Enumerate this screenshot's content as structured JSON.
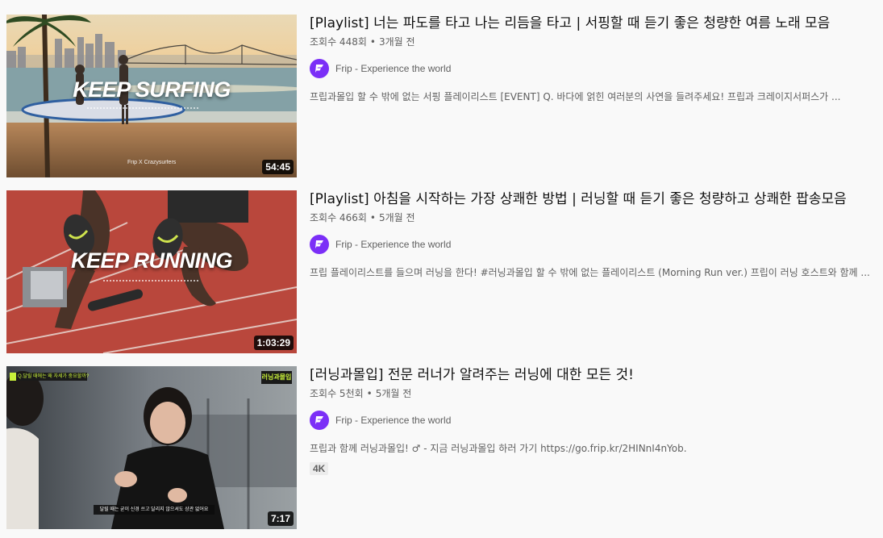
{
  "videos": [
    {
      "title": "[Playlist] 너는 파도를 타고 나는 리듬을 타고 | 서핑할 때 듣기 좋은 청량한 여름 노래 모음",
      "views": "조회수 448회",
      "age": "3개월 전",
      "channel": "Frip - Experience the world",
      "description": "프립과몰입 할 수 밖에 없는 서핑 플레이리스트 [EVENT] Q. 바다에 얽힌 여러분의 사연을 들려주세요! 프립과 크레이지서퍼스가 ...",
      "duration": "54:45",
      "thumb_text": "KEEP SURFING",
      "thumb_small": "Frip X Crazysurfers"
    },
    {
      "title": "[Playlist] 아침을 시작하는 가장 상쾌한 방법 | 러닝할 때 듣기 좋은 청량하고 상쾌한 팝송모음",
      "views": "조회수 466회",
      "age": "5개월 전",
      "channel": "Frip - Experience the world",
      "description": "프립 플레이리스트를 들으며 러닝을 한다! #러닝과몰입 할 수 밖에 없는 플레이리스트 (Morning Run ver.) 프립이 러닝 호스트와 함께 ...",
      "duration": "1:03:29",
      "thumb_text": "KEEP RUNNING"
    },
    {
      "title": "[러닝과몰입] 전문 러너가 알려주는 러닝에 대한 모든 것!",
      "views": "조회수 5천회",
      "age": "5개월 전",
      "channel": "Frip - Experience the world",
      "description": "프립과 함께 러닝과몰입! ♂ - 지금 러닝과몰입 하러 가기 https://go.frip.kr/2HINnI4nYob.",
      "duration": "7:17",
      "badge": "4K",
      "thumb_caption_top": "Q.달릴 때에는 왜 자세가 중요할까?",
      "thumb_caption_bottom": "달릴 때는 굳이 신경 쓰고 달리지 않으셔도 상관 없어요",
      "thumb_logo": "러닝과몰입"
    }
  ],
  "colors": {
    "brand": "#7b2ff7",
    "meta_text": "#606060",
    "title_text": "#0f0f0f",
    "background": "#f9f9f9"
  }
}
